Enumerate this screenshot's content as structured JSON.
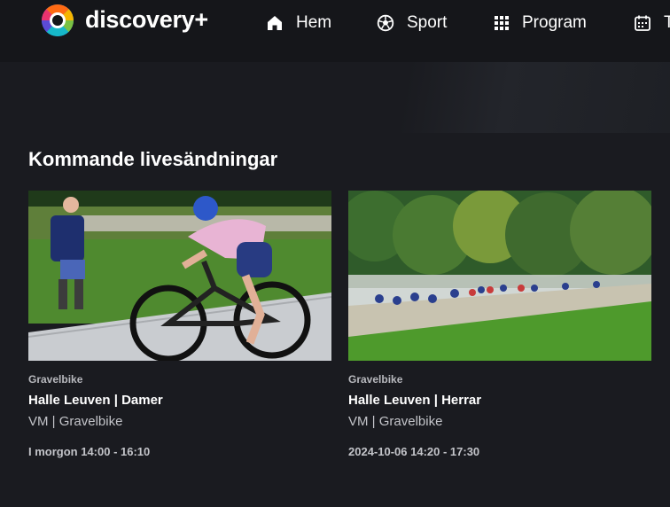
{
  "brand": {
    "name": "discovery+"
  },
  "nav": {
    "items": [
      {
        "label": "Hem",
        "icon": "home-icon"
      },
      {
        "label": "Sport",
        "icon": "soccer-ball-icon"
      },
      {
        "label": "Program",
        "icon": "grid-icon"
      },
      {
        "label": "T",
        "icon": "calendar-icon"
      }
    ]
  },
  "section": {
    "title": "Kommande livesändningar"
  },
  "cards": [
    {
      "category": "Gravelbike",
      "title": "Halle Leuven | Damer",
      "subtitle": "VM | Gravelbike",
      "time": "I morgon 14:00 - 16:10"
    },
    {
      "category": "Gravelbike",
      "title": "Halle Leuven | Herrar",
      "subtitle": "VM | Gravelbike",
      "time": "2024-10-06 14:20 - 17:30"
    }
  ],
  "colors": {
    "background": "#1a1b20",
    "topbar": "#15161a",
    "text_primary": "#ffffff",
    "text_secondary": "#c3c4c9"
  }
}
